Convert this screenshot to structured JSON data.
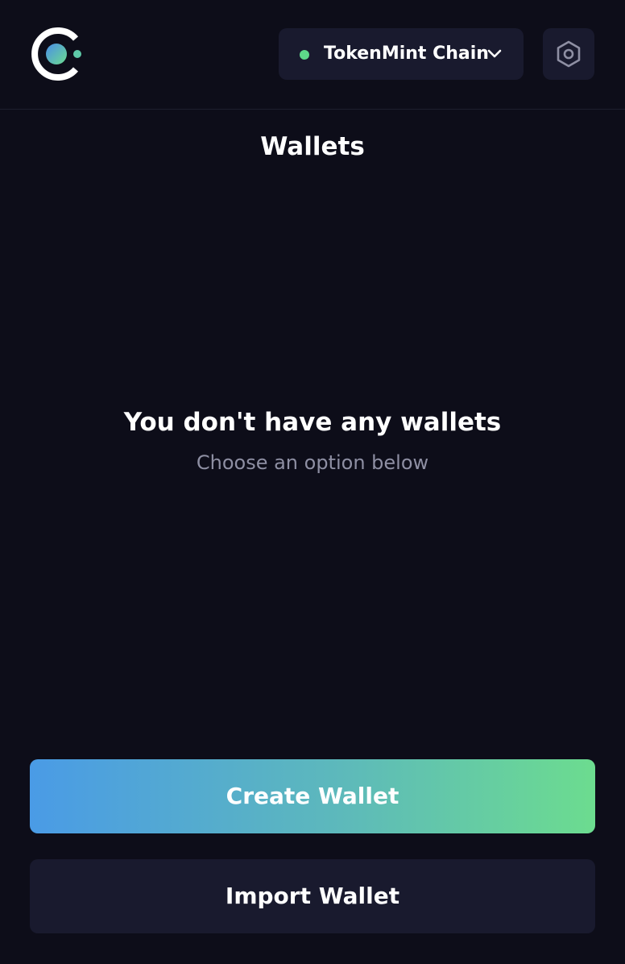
{
  "header": {
    "network": {
      "label": "TokenMint Chain",
      "status_color": "#5ed98a"
    },
    "settings_icon": "hexagon-gear-icon",
    "logo_icon": "app-logo-icon"
  },
  "page": {
    "title": "Wallets"
  },
  "empty_state": {
    "title": "You don't have any wallets",
    "subtitle": "Choose an option below"
  },
  "actions": {
    "create_label": "Create Wallet",
    "import_label": "Import Wallet"
  },
  "colors": {
    "background": "#0d0d19",
    "surface": "#191a2e",
    "gradient_start": "#4a9be6",
    "gradient_end": "#6cdc8f",
    "muted_text": "#8e8fa3"
  }
}
